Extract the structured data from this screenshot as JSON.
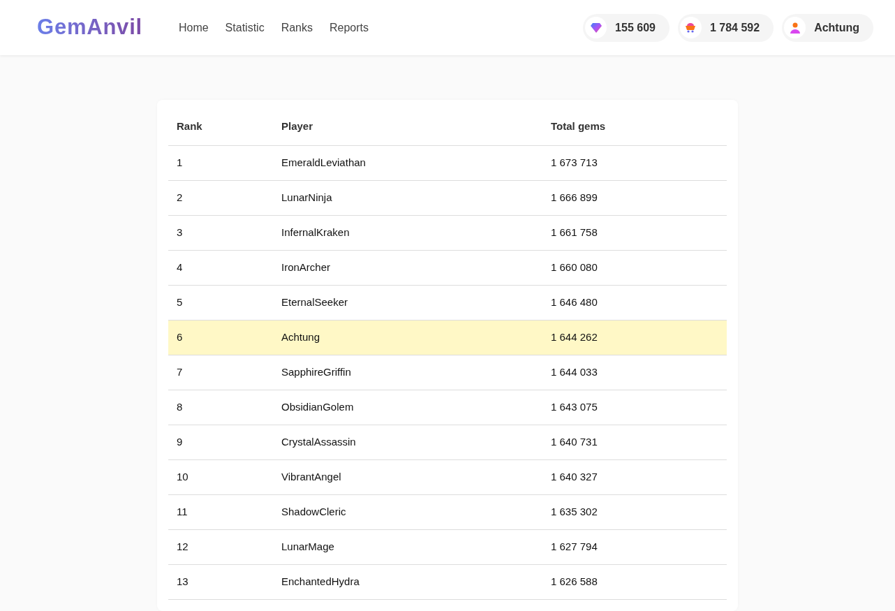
{
  "header": {
    "logo": "GemAnvil",
    "nav": [
      {
        "label": "Home"
      },
      {
        "label": "Statistic"
      },
      {
        "label": "Ranks"
      },
      {
        "label": "Reports"
      }
    ],
    "stats": [
      {
        "kind": "gem",
        "value": "155 609"
      },
      {
        "kind": "cart",
        "value": "1 784 592"
      },
      {
        "kind": "user",
        "value": "Achtung"
      }
    ]
  },
  "table": {
    "columns": [
      "Rank",
      "Player",
      "Total gems"
    ],
    "rows": [
      {
        "rank": "1",
        "player": "EmeraldLeviathan",
        "gems": "1 673 713",
        "selected": false
      },
      {
        "rank": "2",
        "player": "LunarNinja",
        "gems": "1 666 899",
        "selected": false
      },
      {
        "rank": "3",
        "player": "InfernalKraken",
        "gems": "1 661 758",
        "selected": false
      },
      {
        "rank": "4",
        "player": "IronArcher",
        "gems": "1 660 080",
        "selected": false
      },
      {
        "rank": "5",
        "player": "EternalSeeker",
        "gems": "1 646 480",
        "selected": false
      },
      {
        "rank": "6",
        "player": "Achtung",
        "gems": "1 644 262",
        "selected": true
      },
      {
        "rank": "7",
        "player": "SapphireGriffin",
        "gems": "1 644 033",
        "selected": false
      },
      {
        "rank": "8",
        "player": "ObsidianGolem",
        "gems": "1 643 075",
        "selected": false
      },
      {
        "rank": "9",
        "player": "CrystalAssassin",
        "gems": "1 640 731",
        "selected": false
      },
      {
        "rank": "10",
        "player": "VibrantAngel",
        "gems": "1 640 327",
        "selected": false
      },
      {
        "rank": "11",
        "player": "ShadowCleric",
        "gems": "1 635 302",
        "selected": false
      },
      {
        "rank": "12",
        "player": "LunarMage",
        "gems": "1 627 794",
        "selected": false
      },
      {
        "rank": "13",
        "player": "EnchantedHydra",
        "gems": "1 626 588",
        "selected": false
      }
    ]
  }
}
